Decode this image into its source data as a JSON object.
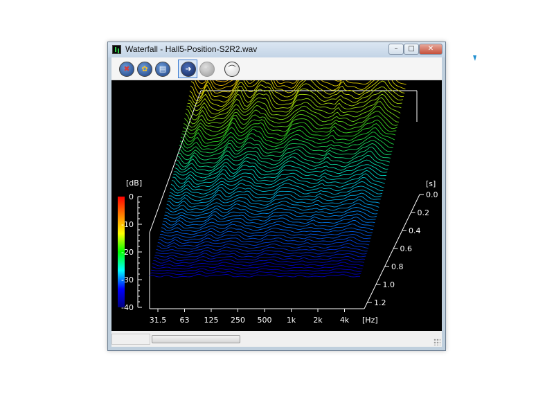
{
  "window": {
    "title": "Waterfall - Hall5-Position-S2R2.wav",
    "buttons": {
      "minimize": "–",
      "maximize": "□",
      "close": "✕"
    }
  },
  "toolbar": {
    "items": [
      {
        "icon": "record-icon",
        "glyph": "✖"
      },
      {
        "icon": "palette-icon",
        "glyph": "✿"
      },
      {
        "icon": "print-icon",
        "glyph": "▤"
      },
      {
        "icon": "arrow-right-icon",
        "glyph": "➜"
      },
      {
        "icon": "arrow-disabled-icon",
        "glyph": "➜"
      },
      {
        "icon": "curve-icon",
        "glyph": "⌒"
      }
    ]
  },
  "colorbar": {
    "unit": "[dB]",
    "ticks": [
      "0",
      "-10",
      "-20",
      "-30",
      "-40"
    ],
    "colors": [
      "#ff0000",
      "#ff8000",
      "#ffff00",
      "#00ff00",
      "#00ffff",
      "#0000ff",
      "#000080"
    ]
  },
  "chart_data": {
    "type": "waterfall",
    "x_unit": "[Hz]",
    "x_ticks": [
      "31.5",
      "63",
      "125",
      "250",
      "500",
      "1k",
      "2k",
      "4k"
    ],
    "y_unit": "[s]",
    "y_ticks": [
      "0.0",
      "0.2",
      "0.4",
      "0.6",
      "0.8",
      "1.0",
      "1.2"
    ],
    "z_unit": "[dB]",
    "z_range": [
      -40,
      0
    ]
  }
}
